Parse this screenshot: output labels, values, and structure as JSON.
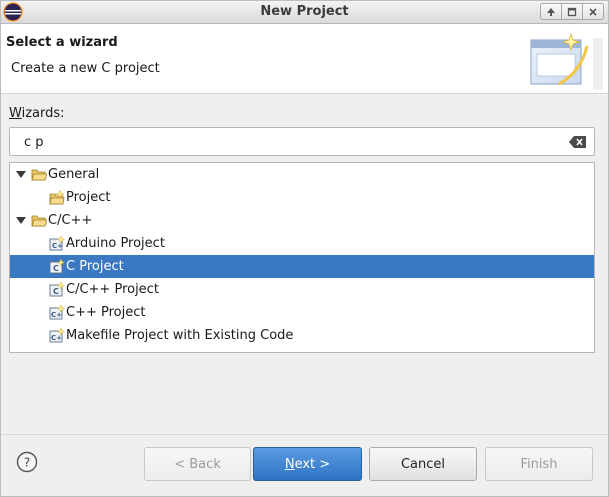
{
  "window": {
    "title": "New Project"
  },
  "header": {
    "title": "Select a wizard",
    "description": "Create a new C project"
  },
  "wizards": {
    "label_prefix": "W",
    "label_rest": "izards:",
    "filter_value": "c p"
  },
  "tree": [
    {
      "label": "General",
      "type": "folder",
      "expanded": true,
      "level": 0
    },
    {
      "label": "Project",
      "type": "project",
      "level": 1
    },
    {
      "label": "C/C++",
      "type": "folder",
      "expanded": true,
      "level": 0
    },
    {
      "label": "Arduino Project",
      "type": "cproject",
      "level": 1
    },
    {
      "label": "C Project",
      "type": "cproject",
      "level": 1,
      "selected": true
    },
    {
      "label": "C/C++ Project",
      "type": "cproject",
      "level": 1
    },
    {
      "label": "C++ Project",
      "type": "cproject",
      "level": 1
    },
    {
      "label": "Makefile Project with Existing Code",
      "type": "cproject",
      "level": 1
    }
  ],
  "buttons": {
    "back": "< Back",
    "next_prefix": "N",
    "next_rest": "ext >",
    "cancel": "Cancel",
    "finish": "Finish"
  },
  "colors": {
    "selection": "#3b78c4",
    "primary_button": "#2f73c5"
  }
}
